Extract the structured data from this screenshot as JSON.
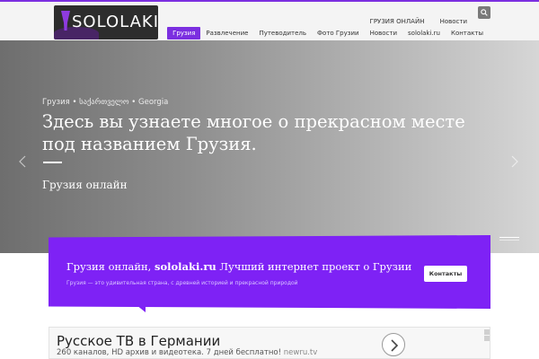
{
  "header": {
    "logo_text": "SOLOLAKI",
    "top_links": [
      "ГРУЗИЯ ОНЛАЙН",
      "Новости"
    ],
    "nav": [
      {
        "label": "Грузия",
        "active": true
      },
      {
        "label": "Развлечение",
        "active": false
      },
      {
        "label": "Путеводитель",
        "active": false
      },
      {
        "label": "Фото Грузии",
        "active": false
      },
      {
        "label": "Новости",
        "active": false
      },
      {
        "label": "sololaki.ru",
        "active": false
      },
      {
        "label": "Контакты",
        "active": false
      }
    ],
    "icons": {
      "search": "search-icon"
    }
  },
  "hero": {
    "breadcrumb": "Грузия • საქართველო • Georgia",
    "headline_line1": "Здесь вы узнаете многое о прекрасном месте",
    "headline_line2": "под названием Грузия.",
    "subtitle": "Грузия онлайн",
    "icons": {
      "prev": "chevron-left-icon",
      "next": "chevron-right-icon"
    }
  },
  "promo": {
    "title_prefix": "Грузия онлайн,",
    "title_brand": "sololaki.ru",
    "title_suffix": "Лучший интернет проект о Грузии",
    "description": "Грузия — это удивительная страна, с древней историей и прекрасной природой",
    "button_label": "Контакты"
  },
  "ad": {
    "title": "Русское ТВ в Германии",
    "description": "260 каналов, HD архив и видеотека. 7 дней бесплатно!",
    "domain": "newru.tv",
    "icons": {
      "go": "chevron-right-circle-icon"
    }
  },
  "colors": {
    "accent": "#7b2fe0",
    "promo_bg": "#7e22f5"
  }
}
